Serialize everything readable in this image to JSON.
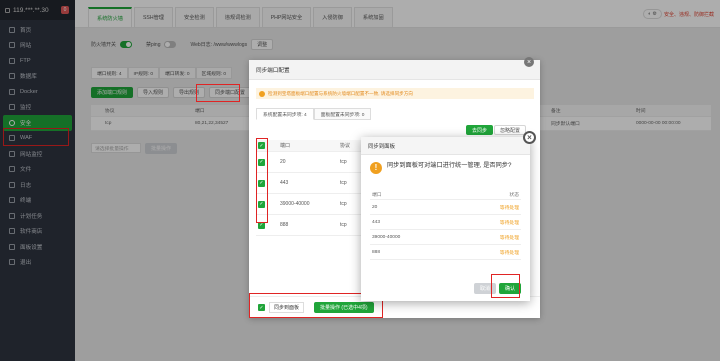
{
  "sidebar": {
    "ip": "119.***.**.30",
    "badge": "0",
    "items": [
      {
        "label": "首页"
      },
      {
        "label": "网站"
      },
      {
        "label": "FTP"
      },
      {
        "label": "数据库"
      },
      {
        "label": "Docker"
      },
      {
        "label": "监控"
      },
      {
        "label": "安全"
      },
      {
        "label": "WAF"
      },
      {
        "label": "网站监控"
      },
      {
        "label": "文件"
      },
      {
        "label": "日志"
      },
      {
        "label": "终端"
      },
      {
        "label": "计划任务"
      },
      {
        "label": "软件商店"
      },
      {
        "label": "面板设置"
      },
      {
        "label": "退出"
      }
    ]
  },
  "tabs": [
    "系统防火墙",
    "SSH管理",
    "安全检测",
    "违规词检测",
    "PHP网站安全",
    "入侵防御",
    "系统加固"
  ],
  "topright": {
    "label": "安全、违规、防御拦截"
  },
  "firewall": {
    "switch_label": "防火墙开关",
    "ping_label": "禁ping",
    "web_log_label": "Web日志: /www/wwwlogs",
    "web_log_btn": "调整"
  },
  "stats": [
    "端口规则: 4",
    "IP规则: 0",
    "端口转发: 0",
    "区域规则: 0"
  ],
  "actions": [
    "添加端口规则",
    "导入规则",
    "导出规则",
    "同步端口配置"
  ],
  "bg_table": {
    "headers": [
      "协议",
      "端口",
      "备注",
      "时间"
    ],
    "row": {
      "protocol": "tcp",
      "port": "80,21,22,34527",
      "note": "同步默认端口",
      "time": "0000-00-00 00:00:00"
    },
    "search_placeholder": "请选择批量操作",
    "batch_btn": "批量操作"
  },
  "dialog1": {
    "title": "同步端口配置",
    "warning": "检测到宝塔面板端口配置与系统防火墙端口配置不一致, 请选择同步方向",
    "subtabs": [
      "系统配置未同步项: 4",
      "面板配置未同步项: 0"
    ],
    "sync_btn": "去同步",
    "ignore_btn": "忽略配置",
    "headers": [
      "端口",
      "协议"
    ],
    "rows": [
      {
        "port": "20",
        "protocol": "tcp"
      },
      {
        "port": "443",
        "protocol": "tcp"
      },
      {
        "port": "39000-40000",
        "protocol": "tcp"
      },
      {
        "port": "888",
        "protocol": "tcp"
      }
    ],
    "footer_label": "同步到面板",
    "footer_btn": "批量操作 (已选中4项)"
  },
  "dialog2": {
    "title": "同步到面板",
    "question": "同步到面板可对端口进行统一管理, 是否同步?",
    "headers": [
      "端口",
      "状态"
    ],
    "rows": [
      {
        "port": "20",
        "status": "等待处理"
      },
      {
        "port": "443",
        "status": "等待处理"
      },
      {
        "port": "39000-40000",
        "status": "等待处理"
      },
      {
        "port": "888",
        "status": "等待处理"
      }
    ],
    "cancel": "取消",
    "confirm": "确认"
  }
}
